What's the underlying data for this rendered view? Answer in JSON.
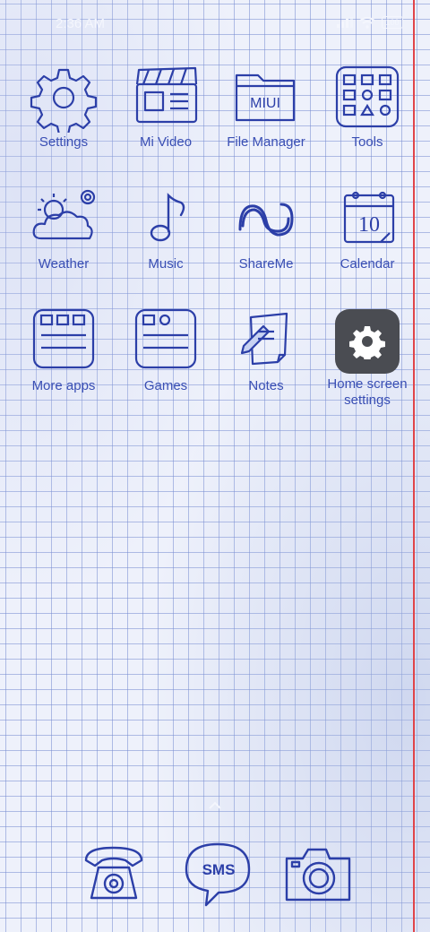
{
  "status": {
    "time": "2:36 AM",
    "battery": "100"
  },
  "apps": [
    {
      "label": "Settings"
    },
    {
      "label": "Mi Video"
    },
    {
      "label": "File Manager",
      "badge": "MIUI"
    },
    {
      "label": "Tools"
    },
    {
      "label": "Weather"
    },
    {
      "label": "Music"
    },
    {
      "label": "ShareMe"
    },
    {
      "label": "Calendar",
      "date": "10"
    },
    {
      "label": "More apps"
    },
    {
      "label": "Games"
    },
    {
      "label": "Notes"
    },
    {
      "label": "Home screen settings"
    }
  ],
  "dock": {
    "sms_text": "SMS"
  },
  "colors": {
    "ink": "#2c3fa8",
    "margin_line": "#e0454a",
    "settings_tile": "#4a4c52"
  }
}
